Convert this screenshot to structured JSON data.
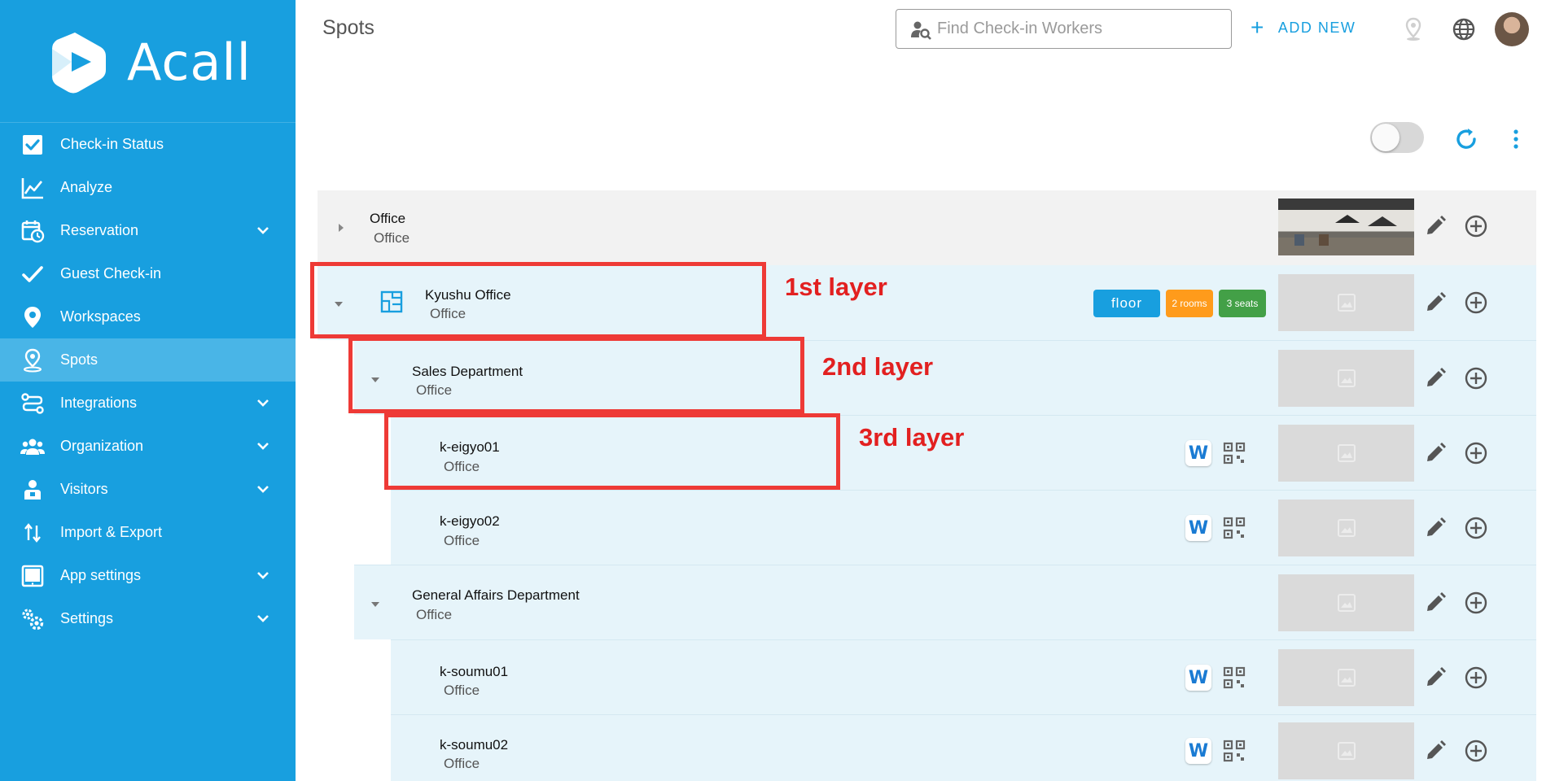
{
  "app": {
    "name": "Acall"
  },
  "sidebar": {
    "items": [
      {
        "label": "Check-in Status",
        "icon": "checkbox-icon",
        "expandable": false
      },
      {
        "label": "Analyze",
        "icon": "line-chart-icon",
        "expandable": false
      },
      {
        "label": "Reservation",
        "icon": "calendar-clock-icon",
        "expandable": true
      },
      {
        "label": "Guest Check-in",
        "icon": "checkmark-icon",
        "expandable": false
      },
      {
        "label": "Workspaces",
        "icon": "location-pin-icon",
        "expandable": false
      },
      {
        "label": "Spots",
        "icon": "person-pin-icon",
        "expandable": false,
        "active": true
      },
      {
        "label": "Integrations",
        "icon": "integration-icon",
        "expandable": true
      },
      {
        "label": "Organization",
        "icon": "people-group-icon",
        "expandable": true
      },
      {
        "label": "Visitors",
        "icon": "visitor-icon",
        "expandable": true
      },
      {
        "label": "Import & Export",
        "icon": "import-export-icon",
        "expandable": false
      },
      {
        "label": "App settings",
        "icon": "tablet-icon",
        "expandable": true
      },
      {
        "label": "Settings",
        "icon": "gears-icon",
        "expandable": true
      }
    ]
  },
  "header": {
    "title": "Spots",
    "search_placeholder": "Find Check-in Workers",
    "add_new_label": "ADD NEW"
  },
  "tree": {
    "rows": [
      {
        "title": "Office",
        "subtitle": "Office",
        "level": 0,
        "expanded": false,
        "image": "photo"
      },
      {
        "title": "Kyushu Office",
        "subtitle": "Office",
        "level": 1,
        "expanded": true,
        "image": "placeholder",
        "badges": {
          "floor": "floor",
          "rooms": "2 rooms",
          "seats": "3 seats"
        }
      },
      {
        "title": "Sales Department",
        "subtitle": "Office",
        "level": 2,
        "expanded": true,
        "image": "placeholder"
      },
      {
        "title": "k-eigyo01",
        "subtitle": "Office",
        "level": 3,
        "image": "placeholder"
      },
      {
        "title": "k-eigyo02",
        "subtitle": "Office",
        "level": 3,
        "image": "placeholder"
      },
      {
        "title": "General Affairs Department",
        "subtitle": "Office",
        "level": 2,
        "expanded": true,
        "image": "placeholder"
      },
      {
        "title": "k-soumu01",
        "subtitle": "Office",
        "level": 3,
        "image": "placeholder"
      },
      {
        "title": "k-soumu02",
        "subtitle": "Office",
        "level": 3,
        "image": "placeholder"
      }
    ]
  },
  "annotations": {
    "layer1": "1st layer",
    "layer2": "2nd layer",
    "layer3": "3rd layer"
  },
  "colors": {
    "brand": "#189fdf",
    "sidebar_active": "#49b5e7",
    "row_tint": "#e6f4fa",
    "highlight": "#ee3a36",
    "rooms_badge": "#ff9b1b",
    "seats_badge": "#43a047"
  }
}
